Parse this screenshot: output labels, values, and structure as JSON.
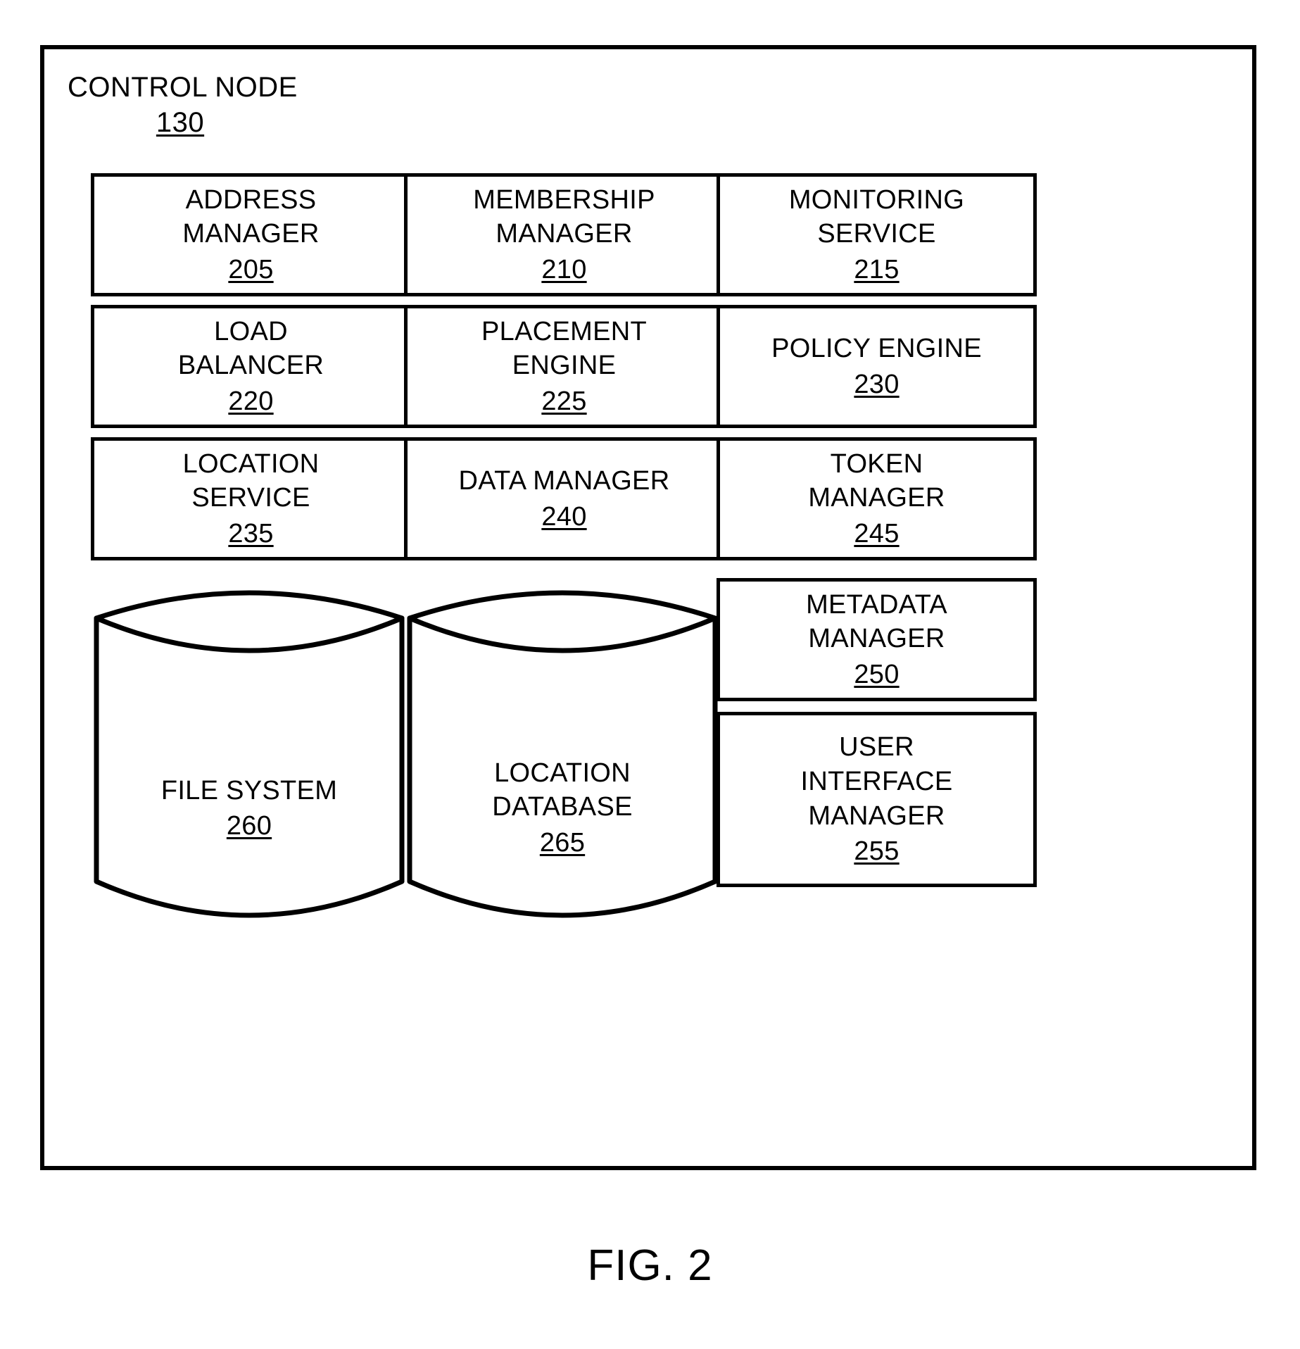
{
  "figure": {
    "caption": "FIG. 2",
    "node_title": "CONTROL NODE",
    "node_ref": "130"
  },
  "components": {
    "address_manager": {
      "label": "ADDRESS\nMANAGER",
      "ref": "205"
    },
    "membership_manager": {
      "label": "MEMBERSHIP\nMANAGER",
      "ref": "210"
    },
    "monitoring_service": {
      "label": "MONITORING\nSERVICE",
      "ref": "215"
    },
    "load_balancer": {
      "label": "LOAD\nBALANCER",
      "ref": "220"
    },
    "placement_engine": {
      "label": "PLACEMENT\nENGINE",
      "ref": "225"
    },
    "policy_engine": {
      "label": "POLICY ENGINE",
      "ref": "230"
    },
    "location_service": {
      "label": "LOCATION\nSERVICE",
      "ref": "235"
    },
    "data_manager": {
      "label": "DATA MANAGER",
      "ref": "240"
    },
    "token_manager": {
      "label": "TOKEN\nMANAGER",
      "ref": "245"
    },
    "metadata_manager": {
      "label": "METADATA\nMANAGER",
      "ref": "250"
    },
    "ui_manager": {
      "label": "USER\nINTERFACE\nMANAGER",
      "ref": "255"
    },
    "file_system": {
      "label": "FILE SYSTEM",
      "ref": "260"
    },
    "location_database": {
      "label": "LOCATION\nDATABASE",
      "ref": "265"
    }
  },
  "colors": {
    "stroke": "#000000",
    "background": "#ffffff"
  }
}
